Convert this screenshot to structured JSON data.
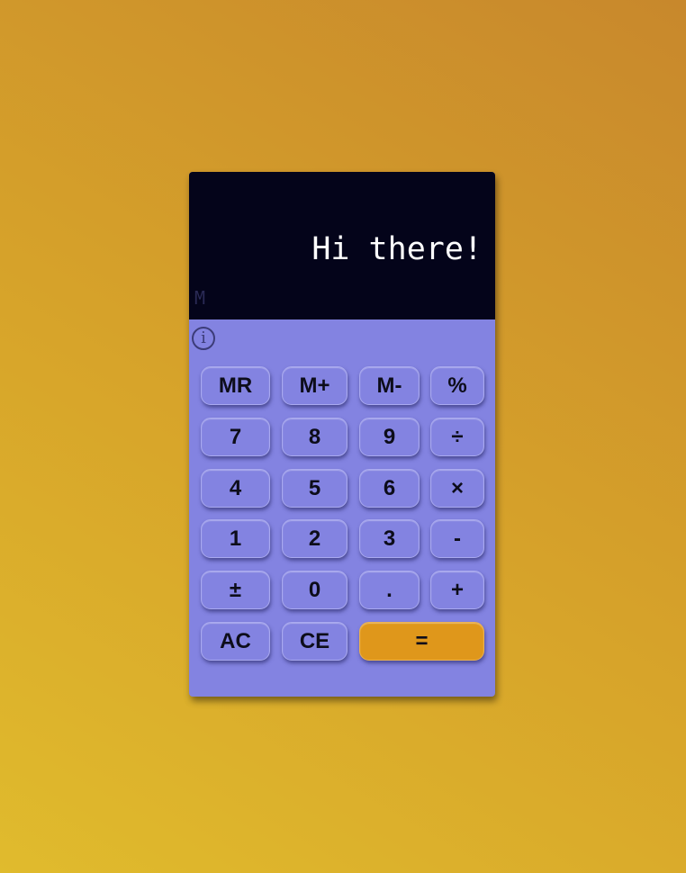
{
  "display": {
    "text": "Hi there!",
    "memory_indicator": "M"
  },
  "info_icon": "i",
  "keys": {
    "mr": "MR",
    "m_plus": "M+",
    "m_minus": "M-",
    "percent": "%",
    "seven": "7",
    "eight": "8",
    "nine": "9",
    "divide": "÷",
    "four": "4",
    "five": "5",
    "six": "6",
    "multiply": "×",
    "one": "1",
    "two": "2",
    "three": "3",
    "subtract": "-",
    "plus_minus": "±",
    "zero": "0",
    "decimal": ".",
    "add": "+",
    "all_clear": "AC",
    "clear_entry": "CE",
    "equals": "="
  },
  "colors": {
    "body": "#8383e1",
    "display_background": "#04041a",
    "equals_key": "#df971b"
  }
}
